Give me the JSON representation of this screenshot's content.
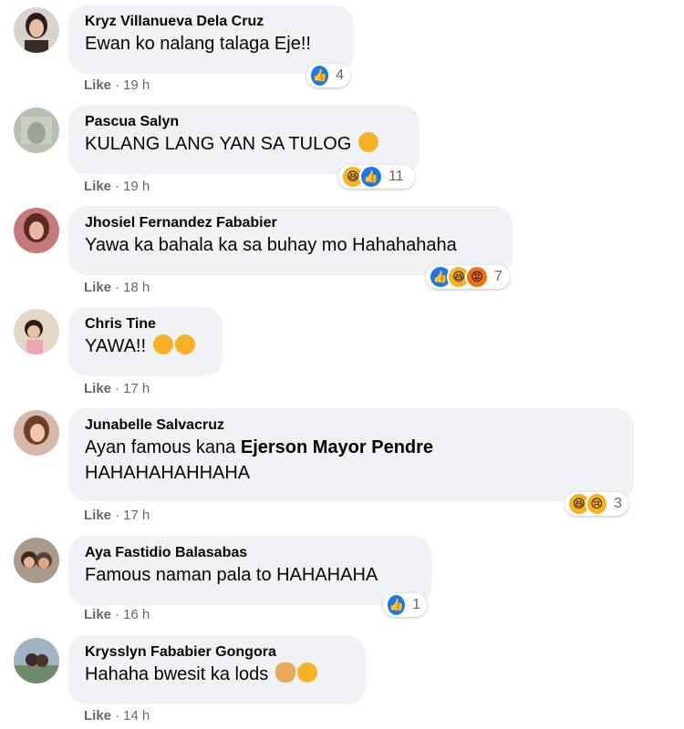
{
  "comments": [
    {
      "author": "Kryz Villanueva Dela Cruz",
      "text": "Ewan ko nalang talaga Eje!!",
      "like_label": "Like",
      "time": "19 h",
      "reaction_count": "4"
    },
    {
      "author": "Pascua Salyn",
      "text": "KULANG LANG YAN SA TULOG",
      "like_label": "Like",
      "time": "19 h",
      "reaction_count": "11"
    },
    {
      "author": "Jhosiel Fernandez Fababier",
      "text": "Yawa ka bahala ka sa buhay mo Hahahahaha",
      "like_label": "Like",
      "time": "18 h",
      "reaction_count": "7"
    },
    {
      "author": "Chris Tine",
      "text": "YAWA!!",
      "like_label": "Like",
      "time": "17 h",
      "reaction_count": ""
    },
    {
      "author": "Junabelle Salvacruz",
      "text": "Ayan famous kana",
      "mention": "Ejerson Mayor Pendre",
      "text2": "HAHAHAHAHHAHA",
      "like_label": "Like",
      "time": "17 h",
      "reaction_count": "3"
    },
    {
      "author": "Aya Fastidio Balasabas",
      "text": "Famous naman pala to HAHAHAHA",
      "like_label": "Like",
      "time": "16 h",
      "reaction_count": "1"
    },
    {
      "author": "Krysslyn Fababier Gongora",
      "text": "Hahaha bwesit ka lods",
      "like_label": "Like",
      "time": "14 h",
      "reaction_count": ""
    }
  ],
  "separator": "·",
  "colors": {
    "bubble": "#f0f2f5",
    "meta": "#65676b",
    "like_reaction": "#1877f2",
    "haha_reaction": "#f7b125",
    "angry_reaction": "#e9710f"
  },
  "icons": {
    "like": "thumbs-up-icon",
    "haha": "laughing-face-icon",
    "sad": "crying-face-icon",
    "angry": "angry-face-icon"
  }
}
